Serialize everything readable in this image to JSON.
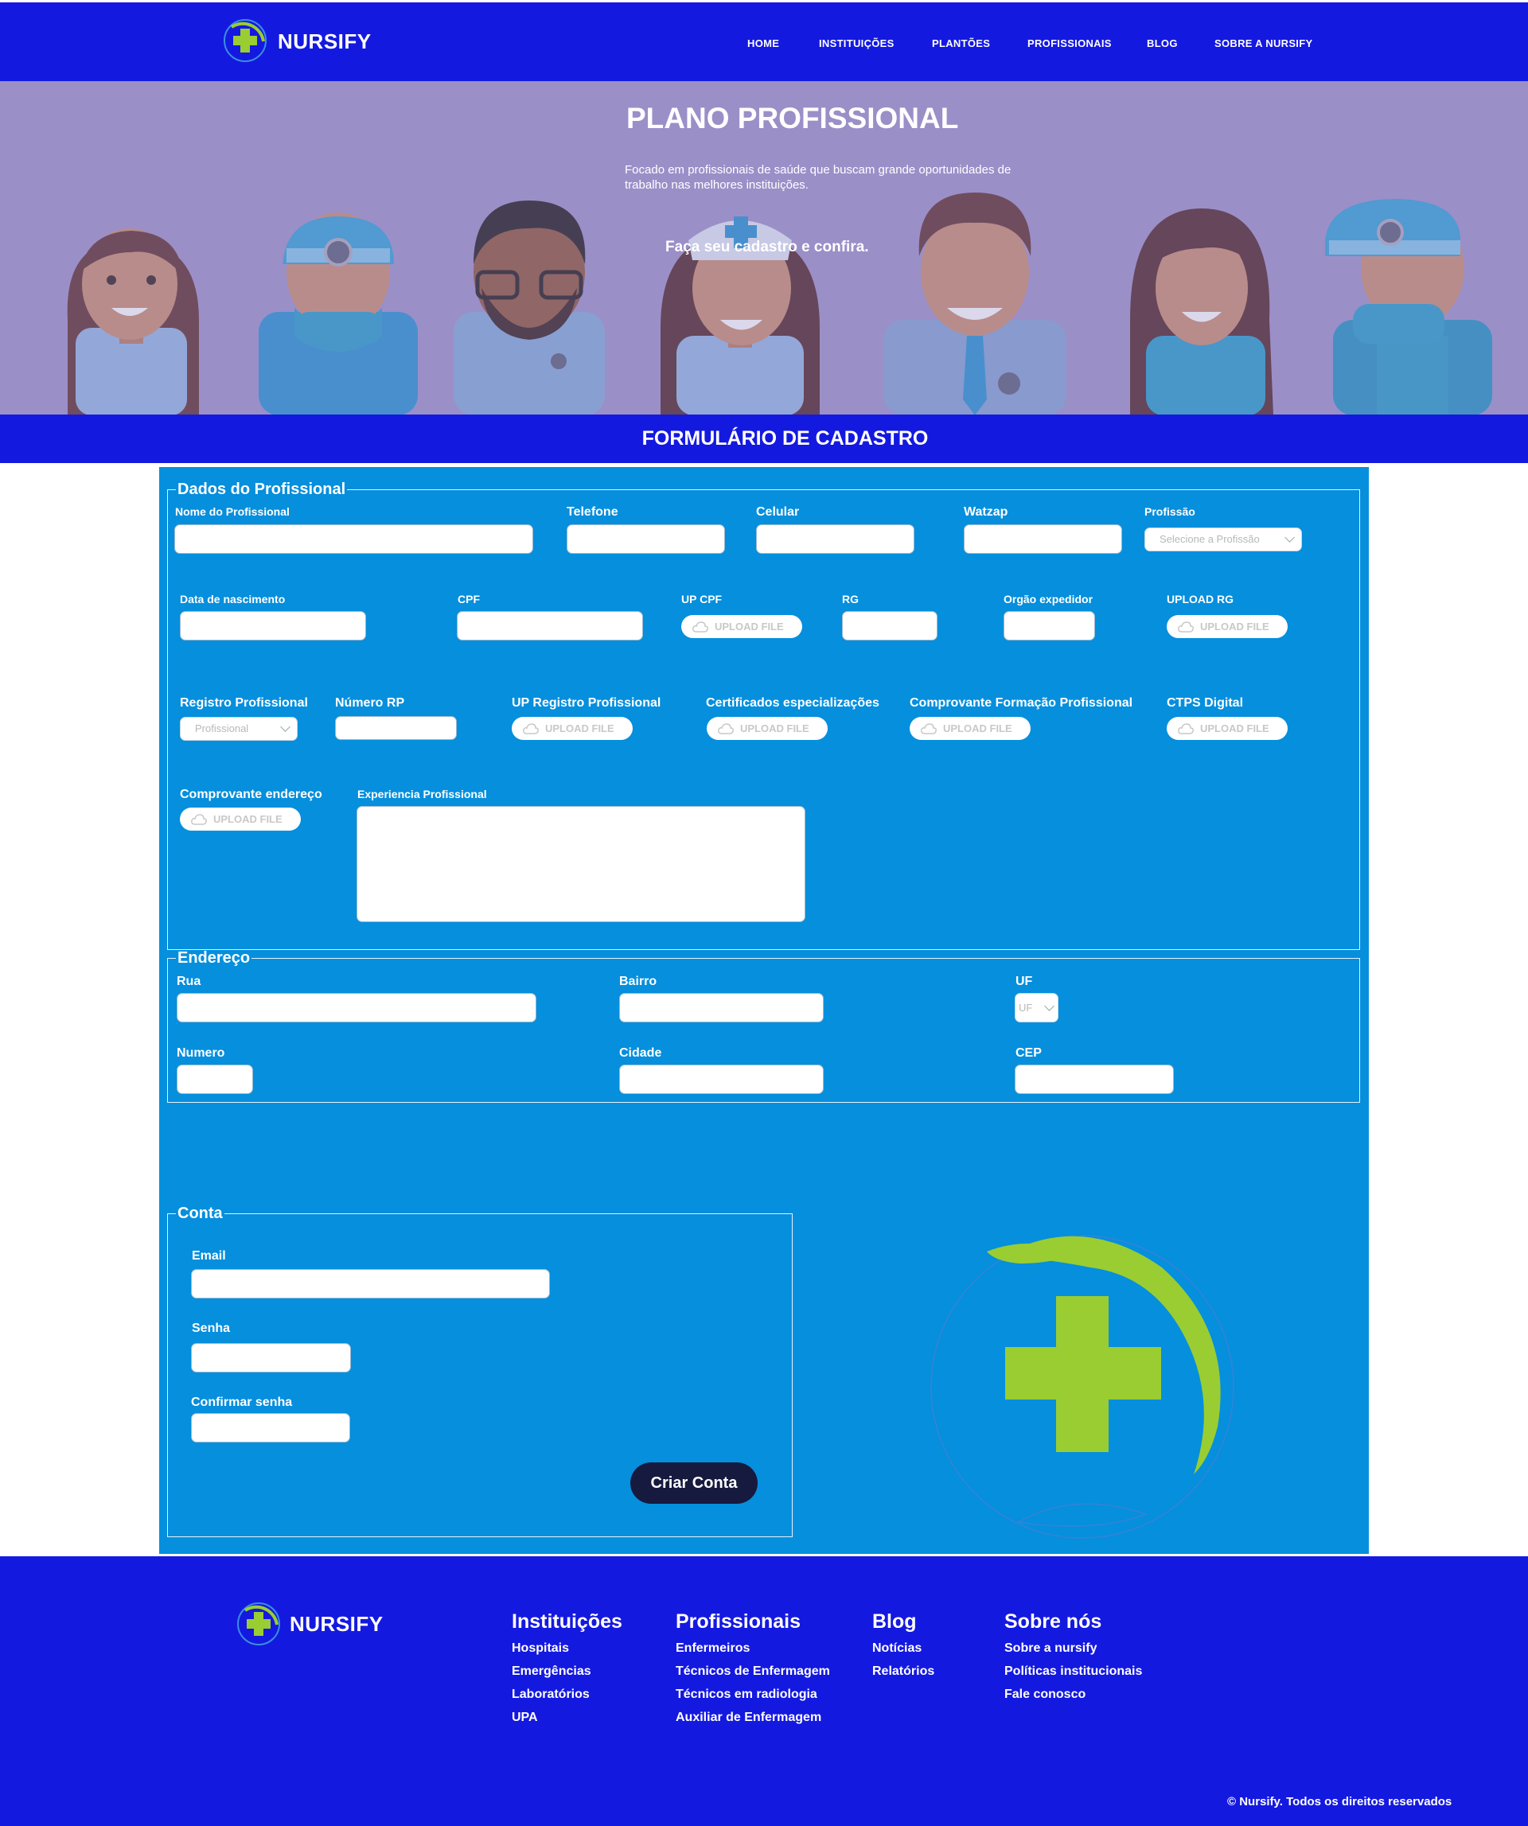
{
  "brand": {
    "name": "NURSIFY"
  },
  "nav": {
    "items": [
      "HOME",
      "INSTITUIÇÕES",
      "PLANTÕES",
      "PROFISSIONAIS",
      "BLOG",
      "SOBRE A NURSIFY"
    ]
  },
  "hero": {
    "title": "PLANO PROFISSIONAL",
    "subtitle": "Focado em profissionais de saúde que buscam grande oportunidades de trabalho nas melhores instituições.",
    "cta": "Faça seu cadastro e confira."
  },
  "form": {
    "title": "FORMULÁRIO DE CADASTRO",
    "upload_label": "UPLOAD FILE",
    "dados": {
      "legend": "Dados do Profissional",
      "nome": "Nome do Profissional",
      "telefone": "Telefone",
      "celular": "Celular",
      "watzap": "Watzap",
      "profissao": "Profissão",
      "profissao_select": "Selecione a Profissão",
      "nascimento": "Data de nascimento",
      "cpf": "CPF",
      "up_cpf": "UP CPF",
      "rg": "RG",
      "orgao": "Orgão expedidor",
      "upload_rg": "UPLOAD RG",
      "registro": "Registro Profissional",
      "registro_select": "Profissional",
      "numero_rp": "Número RP",
      "up_registro": "UP Registro Profissional",
      "certificados": "Certificados especializações",
      "comprovante_formacao": "Comprovante Formação Profissional",
      "ctps": "CTPS Digital",
      "comprovante_endereco": "Comprovante endereço",
      "experiencia": "Experiencia Profissional"
    },
    "endereco": {
      "legend": "Endereço",
      "rua": "Rua",
      "bairro": "Bairro",
      "uf": "UF",
      "uf_select": "UF",
      "numero": "Numero",
      "cidade": "Cidade",
      "cep": "CEP"
    },
    "conta": {
      "legend": "Conta",
      "email": "Email",
      "senha": "Senha",
      "confirmar": "Confirmar senha",
      "button": "Criar Conta"
    }
  },
  "footer": {
    "brand": "NURSIFY",
    "columns": [
      {
        "title": "Instituições",
        "links": [
          "Hospitais",
          "Emergências",
          "Laboratórios",
          "UPA"
        ]
      },
      {
        "title": "Profissionais",
        "links": [
          "Enfermeiros",
          "Técnicos de Enfermagem",
          "Técnicos em radiologia",
          "Auxiliar de Enfermagem"
        ]
      },
      {
        "title": "Blog",
        "links": [
          "Notícias",
          "Relatórios"
        ]
      },
      {
        "title": "Sobre nós",
        "links": [
          "Sobre a nursify",
          "Políticas institucionais",
          "Fale conosco"
        ]
      }
    ],
    "copyright": "© Nursify. Todos os direitos reservados"
  },
  "colors": {
    "header": "#1419e0",
    "panel": "#058fdd",
    "hero": "#9b90c8",
    "accent_green": "#9acd32",
    "button": "#161a3f"
  }
}
